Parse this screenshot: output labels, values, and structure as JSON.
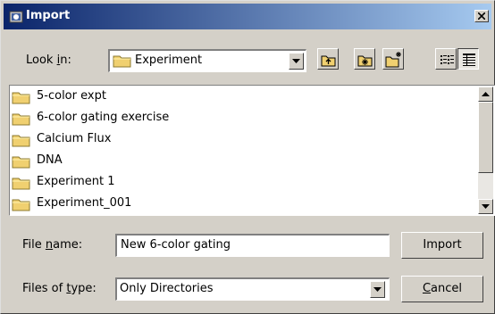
{
  "window": {
    "title": "Import",
    "icon": "app-icon",
    "close_icon": "close-icon"
  },
  "look_in": {
    "label_prefix": "Look ",
    "label_mnemonic": "i",
    "label_suffix": "n:",
    "value": "Experiment",
    "value_icon": "folder-icon"
  },
  "toolbar": {
    "buttons": [
      {
        "name": "up-one-level-icon"
      },
      {
        "name": "home-folder-icon"
      },
      {
        "name": "new-folder-icon"
      },
      {
        "name": "list-view-icon"
      },
      {
        "name": "details-view-icon",
        "pressed": true
      }
    ]
  },
  "list": {
    "items": [
      {
        "label": "5-color expt"
      },
      {
        "label": "6-color gating exercise"
      },
      {
        "label": "Calcium Flux"
      },
      {
        "label": "DNA"
      },
      {
        "label": "Experiment 1"
      },
      {
        "label": "Experiment_001"
      }
    ]
  },
  "file_name": {
    "label_prefix": "File ",
    "label_mnemonic": "n",
    "label_suffix": "ame:",
    "value": "New 6-color gating"
  },
  "file_type": {
    "label_prefix": "Files of ",
    "label_mnemonic": "t",
    "label_suffix": "ype:",
    "value": "Only Directories"
  },
  "buttons": {
    "import_label": "Import",
    "cancel_mnemonic": "C",
    "cancel_rest": "ancel"
  },
  "colors": {
    "title_gradient_start": "#0a246a",
    "title_gradient_end": "#a6caf0",
    "face": "#d4d0c8",
    "folder": "#f0d070"
  }
}
